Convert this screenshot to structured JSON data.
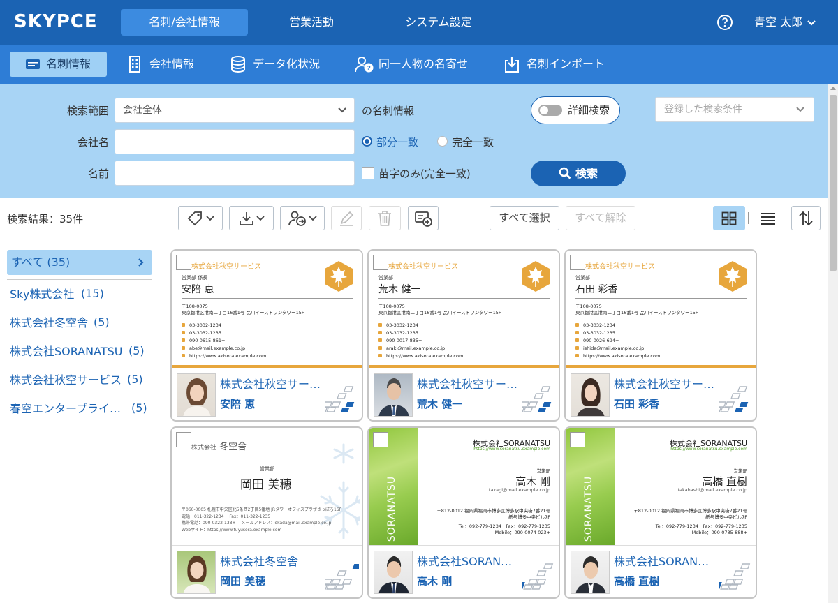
{
  "header": {
    "logo": "SKYPCE",
    "nav": [
      "名刺/会社情報",
      "営業活動",
      "システム設定"
    ],
    "user_name": "青空 太郎"
  },
  "subnav": [
    "名刺情報",
    "会社情報",
    "データ化状況",
    "同一人物の名寄せ",
    "名刺インポート"
  ],
  "search": {
    "scope_label": "検索範囲",
    "scope_value": "会社全体",
    "scope_suffix": "の名刺情報",
    "company_label": "会社名",
    "name_label": "名前",
    "match_partial": "部分一致",
    "match_exact": "完全一致",
    "surname_only": "苗字のみ(完全一致)",
    "advanced": "詳細検索",
    "saved_placeholder": "登録した検索条件",
    "search_button": "検索"
  },
  "toolbar": {
    "result_count": "検索結果：35件",
    "select_all": "すべて選択",
    "deselect_all": "すべて解除"
  },
  "sidebar": {
    "all": "すべて (35)",
    "items": [
      {
        "name": "Sky株式会社",
        "count": "(15)"
      },
      {
        "name": "株式会社冬空舎",
        "count": "(5)"
      },
      {
        "name": "株式会社SORANATSU",
        "count": "(5)"
      },
      {
        "name": "株式会社秋空サービス",
        "count": "(5)"
      },
      {
        "name": "春空エンタープライ…",
        "count": "(5)"
      }
    ]
  },
  "cards": [
    {
      "company": "株式会社秋空サー…",
      "name": "安陪 恵",
      "face": {
        "logo": "株式会社秋空サービス",
        "dept": "営業部 係長",
        "name": "安陪 恵",
        "zip": "〒108-0075",
        "addr": "東京都港区港南二丁目16番1号 品川イーストワンタワー15F",
        "tel": "03-3032-1234",
        "fax": "03-3032-1235",
        "mobile": "090-0615-861+",
        "mail": "abe@mail.example.co.jp",
        "web": "https://www.akisora.example.com"
      }
    },
    {
      "company": "株式会社秋空サー…",
      "name": "荒木 健一",
      "face": {
        "logo": "株式会社秋空サービス",
        "dept": "営業部",
        "name": "荒木 健一",
        "zip": "〒108-0075",
        "addr": "東京都港区港南二丁目16番1号 品川イーストワンタワー15F",
        "tel": "03-3032-1234",
        "fax": "03-3032-1235",
        "mobile": "090-0017-835+",
        "mail": "araki@mail.example.co.jp",
        "web": "https://www.akisora.example.com"
      }
    },
    {
      "company": "株式会社秋空サー…",
      "name": "石田 彩香",
      "face": {
        "logo": "株式会社秋空サービス",
        "dept": "営業部",
        "name": "石田 彩香",
        "zip": "〒108-0075",
        "addr": "東京都港区港南二丁目16番1号 品川イーストワンタワー15F",
        "tel": "03-3032-1234",
        "fax": "03-3032-1235",
        "mobile": "090-0026-694+",
        "mail": "ishida@mail.example.co.jp",
        "web": "https://www.akisora.example.com"
      }
    },
    {
      "company": "株式会社冬空舎",
      "name": "岡田 美穂",
      "face": {
        "logo_small": "株式会社",
        "logo": "冬空舎",
        "dept": "営業部",
        "name": "岡田 美穂",
        "addr": "〒060-0005 札幌市中央区北5条西2丁目5番地 JRタワーオフィスプラザさっぽろ16F",
        "tel": "電話：011-322-1234　 Fax：011-322-1235",
        "mobile": "携帯電話：090-0322-138+　 メールアドレス：okada@mail.example.co.jp",
        "web": "Webサイト：https://www.fuyusora.example.com"
      }
    },
    {
      "company": "株式会社SORAN…",
      "name": "高木 剛",
      "face": {
        "logo": "株式会社SORANATSU",
        "url": "https://www.soranatsu.example.com",
        "vert": "SORANATSU",
        "dept": "営業部",
        "name": "高木 剛",
        "mail": "takagi@mail.example.co.jp",
        "addr1": "〒812-0012 福岡県福岡市博多区博多駅中央街7番21号",
        "addr2": "紙与博多中央ビル7F",
        "telfax": "Tel：092-779-1234　Fax：092-779-1235",
        "mobile": "Mobile：090-0074-023+"
      }
    },
    {
      "company": "株式会社SORAN…",
      "name": "高橋 直樹",
      "face": {
        "logo": "株式会社SORANATSU",
        "url": "https://www.soranatsu.example.com",
        "vert": "SORANATSU",
        "dept": "営業部",
        "name": "高橋 直樹",
        "mail": "takahashi@mail.example.co.jp",
        "addr1": "〒812-0012 福岡県福岡市博多区博多駅中央街7番21号",
        "addr2": "紙与博多中央ビル7F",
        "telfax": "Tel：092-779-1234　Fax：092-779-1235",
        "mobile": "Mobile：090-0785-888+"
      }
    }
  ],
  "colors": {
    "primary": "#1b63b3",
    "header": "#1b63b3",
    "subheader": "#2e7dd6",
    "search_bg": "#a8d4f5",
    "akisora_accent": "#e7a63c",
    "soranatsu_green": "#8fc63c"
  }
}
